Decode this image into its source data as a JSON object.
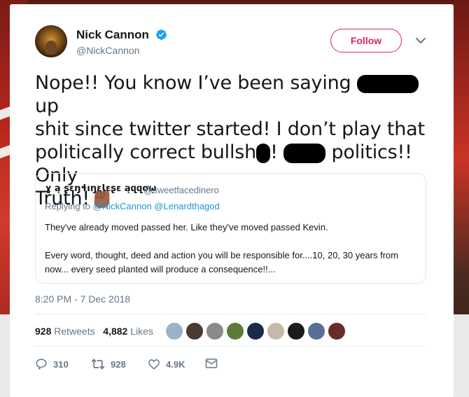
{
  "author": {
    "name": "Nick Cannon",
    "handle": "@NickCannon",
    "verified_icon": "verified-badge-icon",
    "follow_label": "Follow"
  },
  "tweet": {
    "line1_a": "Nope!! You know I’ve been saying",
    "line1_b": "up",
    "line2": "shit since twitter started! I don’t play that",
    "line3_a": "politically correct bullsh",
    "line3_b": "!",
    "line3_c": "politics!! Only",
    "line4": "Truth!",
    "emoji": "raised-fist-medium-dark-icon"
  },
  "quote": {
    "name": "ɣ ą ʂɛŋɬıŋɛƖɛʂɛ ąզզơῳ",
    "handle": "@sweetfacedinero",
    "replying_to_label": "Replying to",
    "reply_handles": "@NickCannon @Lenardthagod",
    "body_p1": "They've already moved passed her. Like they've moved passed Kevin.",
    "body_p2": "Every word, thought, deed and action you will be responsible for....10, 20, 30 years from now... every seed planted will produce a consequence!!..."
  },
  "timestamp": "8:20 PM - 7 Dec 2018",
  "stats": {
    "retweets_count": "928",
    "retweets_label": "Retweets",
    "likes_count": "4,882",
    "likes_label": "Likes"
  },
  "actions": {
    "replies": "310",
    "retweets": "928",
    "likes": "4.9K"
  },
  "colors": {
    "accent_follow": "#e0245e",
    "link": "#1b95e0",
    "muted": "#657786",
    "text": "#14171a"
  }
}
